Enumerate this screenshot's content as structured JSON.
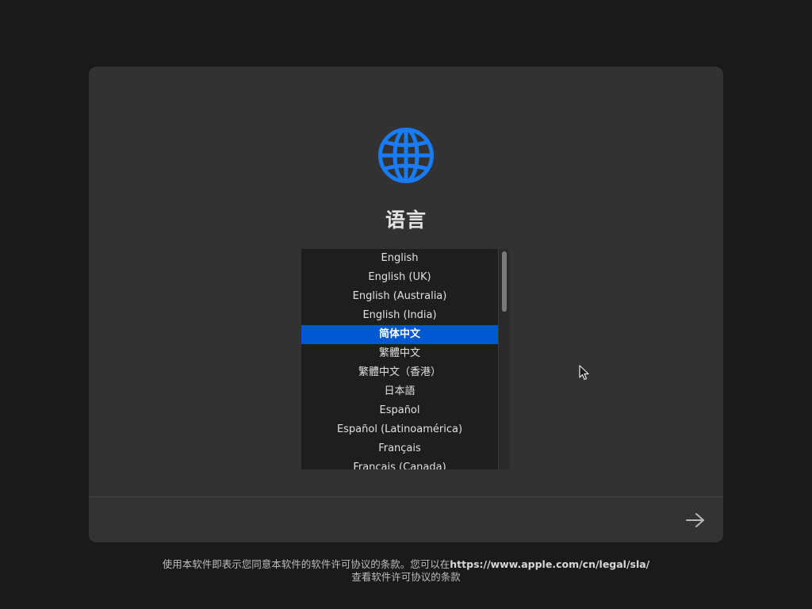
{
  "title": "语言",
  "languages": [
    "English",
    "English (UK)",
    "English (Australia)",
    "English (India)",
    "简体中文",
    "繁體中文",
    "繁體中文（香港）",
    "日本語",
    "Español",
    "Español (Latinoamérica)",
    "Français",
    "Français (Canada)"
  ],
  "selected_language": "简体中文",
  "license": {
    "line1_prefix": "使用本软件即表示您同意本软件的软件许可协议的条款。您可以在",
    "url": "https://www.apple.com/cn/legal/sla/",
    "line2": "查看软件许可协议的条款"
  },
  "icons": {
    "globe": "globe-icon",
    "next": "arrow-right-icon"
  },
  "colors": {
    "accent": "#1a7cf5",
    "selection": "#0058d0"
  }
}
